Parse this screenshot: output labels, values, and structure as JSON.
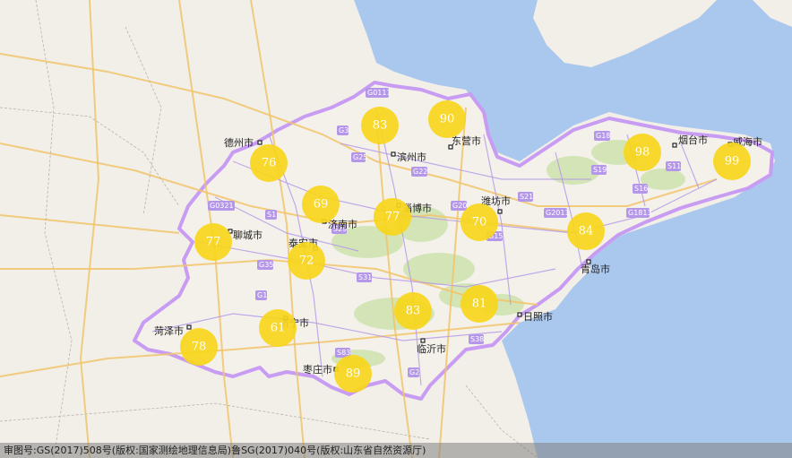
{
  "map": {
    "cities": [
      {
        "id": "dezhou",
        "name": "德州市"
      },
      {
        "id": "binzhou",
        "name": "滨州市"
      },
      {
        "id": "dongying",
        "name": "东营市"
      },
      {
        "id": "yantai",
        "name": "烟台市"
      },
      {
        "id": "weihai",
        "name": "威海市"
      },
      {
        "id": "jinan",
        "name": "济南市"
      },
      {
        "id": "zibo",
        "name": "淄博市"
      },
      {
        "id": "weifang",
        "name": "潍坊市"
      },
      {
        "id": "liaocheng",
        "name": "聊城市"
      },
      {
        "id": "taian",
        "name": "泰安市"
      },
      {
        "id": "qingdao",
        "name": "青岛市"
      },
      {
        "id": "heze",
        "name": "菏泽市"
      },
      {
        "id": "jining",
        "name": "济宁市"
      },
      {
        "id": "rizhao",
        "name": "日照市"
      },
      {
        "id": "linyi",
        "name": "临沂市"
      },
      {
        "id": "zaozhuang",
        "name": "枣庄市"
      }
    ],
    "markers": [
      {
        "id": "binzhou",
        "value": "83"
      },
      {
        "id": "dongying",
        "value": "90"
      },
      {
        "id": "dezhou",
        "value": "76"
      },
      {
        "id": "yantai",
        "value": "98"
      },
      {
        "id": "weihai",
        "value": "99"
      },
      {
        "id": "jinan",
        "value": "69"
      },
      {
        "id": "zibo",
        "value": "77"
      },
      {
        "id": "weifang",
        "value": "70"
      },
      {
        "id": "liaocheng",
        "value": "77"
      },
      {
        "id": "taian",
        "value": "72"
      },
      {
        "id": "qingdao",
        "value": "84"
      },
      {
        "id": "linyi",
        "value": "83"
      },
      {
        "id": "rizhao",
        "value": "81"
      },
      {
        "id": "heze",
        "value": "78"
      },
      {
        "id": "jining",
        "value": "61"
      },
      {
        "id": "zaozhuang",
        "value": "89"
      }
    ],
    "road_labels": [
      "G0111",
      "G25",
      "G18",
      "G3",
      "G2",
      "G20",
      "G22",
      "G15",
      "G35",
      "G1813",
      "G2011",
      "G0321",
      "S1",
      "S11",
      "S16",
      "S19",
      "S21",
      "S29",
      "S31",
      "S38",
      "S83",
      "G1"
    ],
    "colors": {
      "sea": "#aac8ee",
      "land": "#f2efe9",
      "boundary": "#c89cf2",
      "marker": "#f7d61b"
    }
  },
  "footer": {
    "copyright": "审图号:GS(2017)508号(版权:国家测绘地理信息局)鲁SG(2017)040号(版权:山东省自然资源厅)"
  }
}
